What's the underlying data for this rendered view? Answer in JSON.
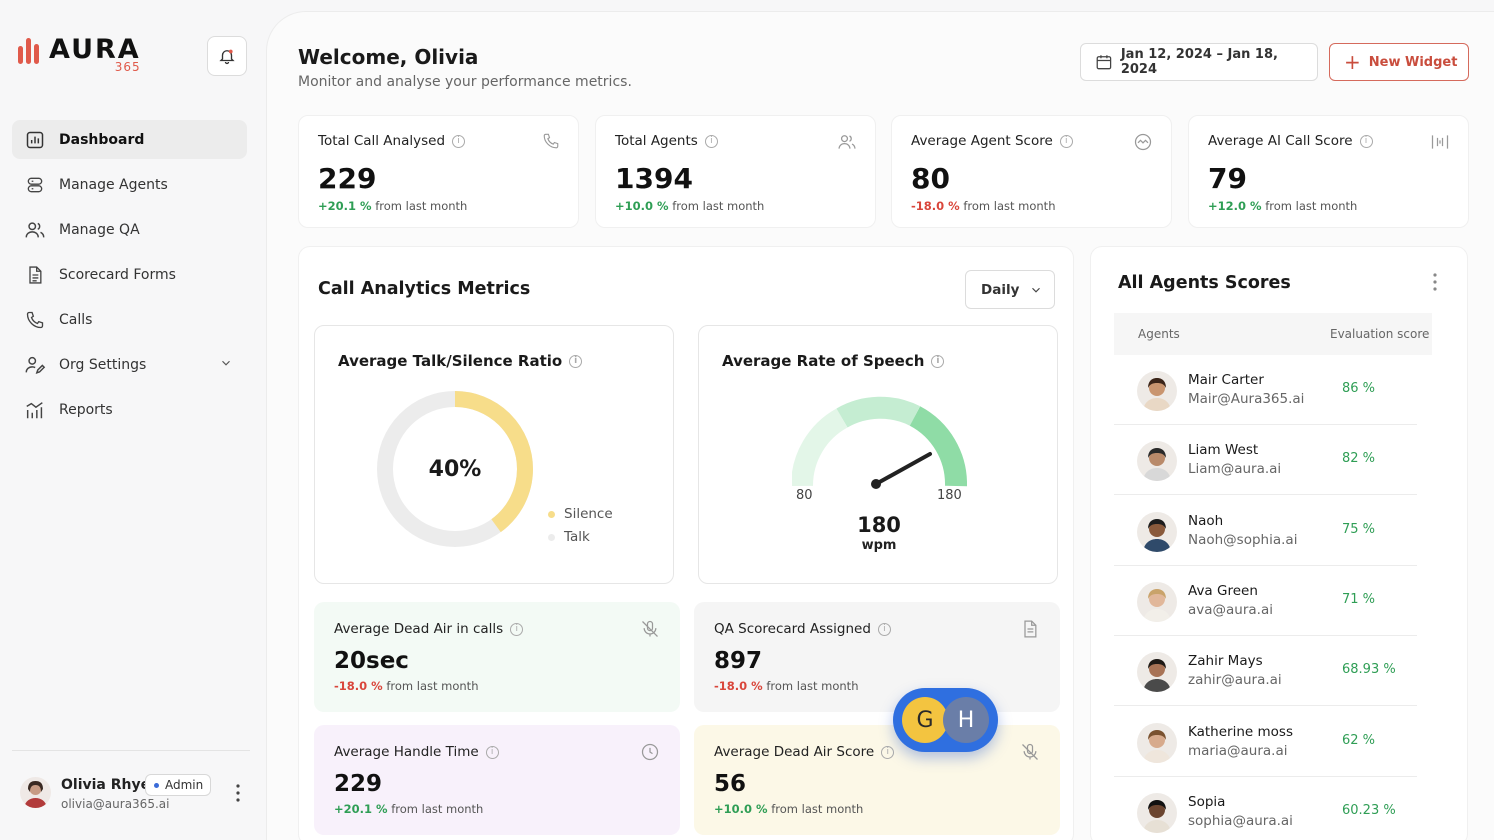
{
  "brand": {
    "name": "AURA",
    "sub": "365"
  },
  "sidebar": {
    "items": [
      {
        "label": "Dashboard",
        "icon": "chart-bar-icon"
      },
      {
        "label": "Manage Agents",
        "icon": "database-icon"
      },
      {
        "label": "Manage QA",
        "icon": "users-icon"
      },
      {
        "label": "Scorecard Forms",
        "icon": "document-icon"
      },
      {
        "label": "Calls",
        "icon": "phone-icon"
      },
      {
        "label": "Org Settings",
        "icon": "user-settings-icon"
      },
      {
        "label": "Reports",
        "icon": "reports-icon"
      }
    ]
  },
  "profile": {
    "name": "Olivia Rhye",
    "role": "Admin",
    "email": "olivia@aura365.ai"
  },
  "header": {
    "welcome": "Welcome, Olivia",
    "subtitle": "Monitor and analyse your performance metrics.",
    "date_range": "Jan 12, 2024 – Jan 18, 2024",
    "new_widget": "New Widget"
  },
  "stats": [
    {
      "title": "Total Call Analysed",
      "value": "229",
      "change": "+20.1 %",
      "suffix": "from last month"
    },
    {
      "title": "Total Agents",
      "value": "1394",
      "change": "+10.0 %",
      "suffix": "from last month"
    },
    {
      "title": "Average Agent Score",
      "value": "80",
      "change": "-18.0 %",
      "suffix": "from last month"
    },
    {
      "title": "Average AI Call Score",
      "value": "79",
      "change": "+12.0 %",
      "suffix": "from last month"
    }
  ],
  "analytics": {
    "title": "Call Analytics Metrics",
    "period": "Daily",
    "talk_silence": {
      "title": "Average Talk/Silence Ratio",
      "percent_label": "40%",
      "silence_fraction": 0.4,
      "legend_silence": "Silence",
      "legend_talk": "Talk"
    },
    "speech": {
      "title": "Average Rate of Speech",
      "min": "80",
      "max": "180",
      "value": "180",
      "unit": "wpm"
    },
    "metrics": [
      {
        "title": "Average Dead Air  in calls",
        "value": "20sec",
        "change": "-18.0 %",
        "suffix": "from last month"
      },
      {
        "title": "QA Scorecard Assigned",
        "value": "897",
        "change": "-18.0 %",
        "suffix": "from last month"
      },
      {
        "title": "Average Handle Time",
        "value": "229",
        "change": "+20.1 %",
        "suffix": "from last month"
      },
      {
        "title": "Average Dead Air Score",
        "value": "56",
        "change": "+10.0 %",
        "suffix": "from last month"
      }
    ]
  },
  "gh_badge": {
    "g": "G",
    "h": "H"
  },
  "agents": {
    "title": "All Agents Scores",
    "col_agents": "Agents",
    "col_score": "Evaluation score",
    "rows": [
      {
        "name": "Mair Carter",
        "email": "Mair@Aura365.ai",
        "score": "86 %"
      },
      {
        "name": "Liam West",
        "email": "Liam@aura.ai",
        "score": "82 %"
      },
      {
        "name": "Naoh",
        "email": "Naoh@sophia.ai",
        "score": "75 %"
      },
      {
        "name": "Ava Green",
        "email": "ava@aura.ai",
        "score": "71 %"
      },
      {
        "name": "Zahir Mays",
        "email": "zahir@aura.ai",
        "score": "68.93 %"
      },
      {
        "name": "Katherine moss",
        "email": "maria@aura.ai",
        "score": "62 %"
      },
      {
        "name": "Sopia",
        "email": "sophia@aura.ai",
        "score": "60.23 %"
      }
    ]
  },
  "colors": {
    "accent": "#e05a4b",
    "positive": "#2f9e55",
    "negative": "#d9463b",
    "donut_silence": "#f7dd8a",
    "donut_talk": "#ececec"
  }
}
